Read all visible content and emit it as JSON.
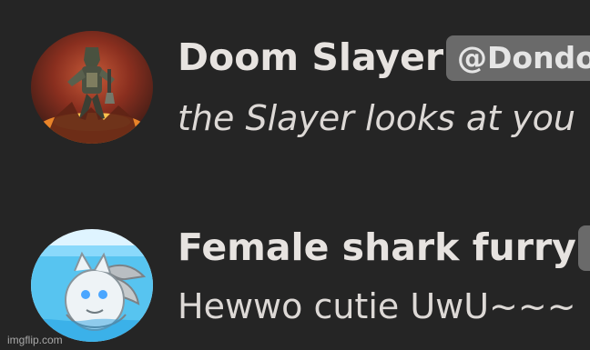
{
  "messages": [
    {
      "username": "Doom Slayer",
      "handle": "@Dondo",
      "text": "the Slayer looks at you",
      "avatar_icon": "doom-slayer-avatar"
    },
    {
      "username": "Female shark furry",
      "handle": "",
      "text": "Hewwo cutie UwU~~~",
      "avatar_icon": "shark-furry-avatar"
    }
  ],
  "watermark": "imgflip.com",
  "colors": {
    "background": "#252525",
    "username": "#e7e3e0",
    "message_text": "#ddd9d6",
    "badge_background": "#6a6a6a"
  }
}
